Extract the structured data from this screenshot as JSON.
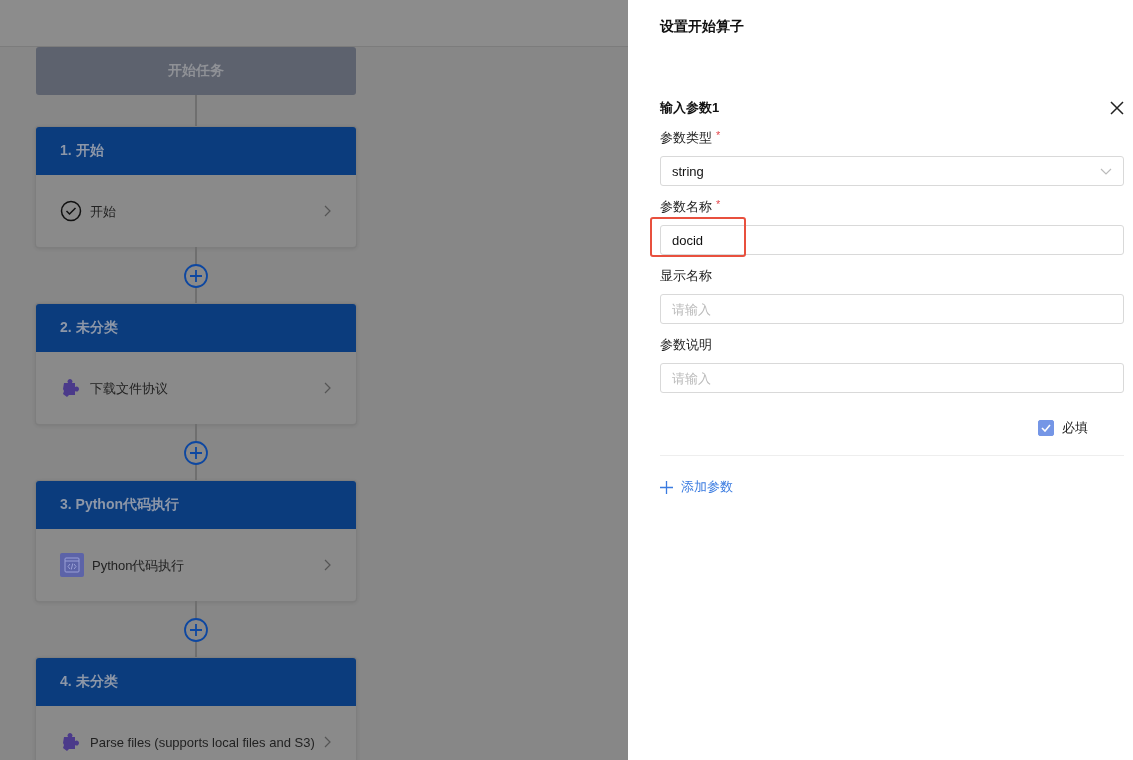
{
  "canvas": {
    "start_node": "开始任务",
    "nodes": [
      {
        "title": "1. 开始",
        "item": {
          "kind": "check",
          "label": "开始"
        }
      },
      {
        "title": "2. 未分类",
        "item": {
          "kind": "plugin",
          "label": "下载文件协议"
        }
      },
      {
        "title": "3. Python代码执行",
        "item": {
          "kind": "code",
          "label": "Python代码执行"
        }
      },
      {
        "title": "4. 未分类",
        "item": {
          "kind": "plugin",
          "label": "Parse files (supports local files and S3)"
        }
      }
    ]
  },
  "panel": {
    "title": "设置开始算子",
    "params": [
      {
        "title": "输入参数1",
        "fields": [
          {
            "kind": "select",
            "label": "参数类型",
            "required_mark": "*",
            "value": "string"
          },
          {
            "kind": "input",
            "label": "参数名称",
            "required_mark": "*",
            "value": "docid",
            "highlighted": true
          },
          {
            "kind": "input",
            "label": "显示名称",
            "placeholder": "请输入"
          },
          {
            "kind": "input",
            "label": "参数说明",
            "placeholder": "请输入"
          }
        ],
        "required_checkbox": {
          "label": "必填",
          "checked": true
        }
      }
    ],
    "add_button": "添加参数"
  }
}
